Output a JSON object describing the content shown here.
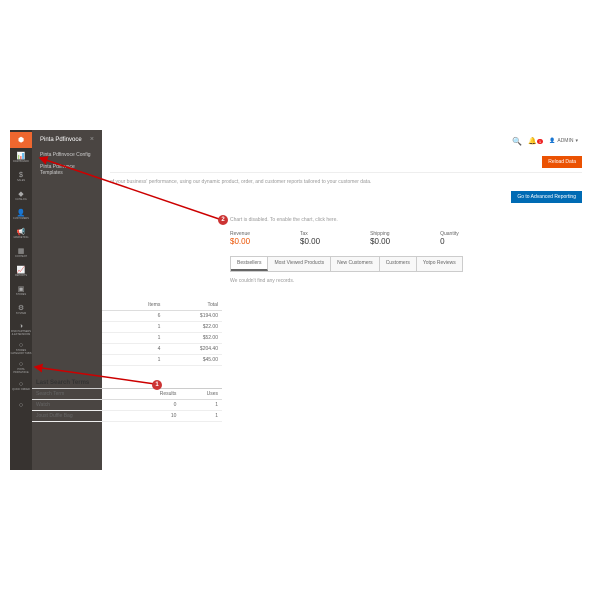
{
  "sidebar": {
    "items": [
      {
        "icon": "⬢",
        "label": ""
      },
      {
        "icon": "📊",
        "label": "DASHBOARD"
      },
      {
        "icon": "$",
        "label": "SALES"
      },
      {
        "icon": "◆",
        "label": "CATALOG"
      },
      {
        "icon": "👤",
        "label": "CUSTOMERS"
      },
      {
        "icon": "📢",
        "label": "MARKETING"
      },
      {
        "icon": "▦",
        "label": "CONTENT"
      },
      {
        "icon": "📈",
        "label": "REPORTS"
      },
      {
        "icon": "▣",
        "label": "STORES"
      },
      {
        "icon": "⚙",
        "label": "SYSTEM"
      },
      {
        "icon": "◑",
        "label": "FIND PARTNERS & EXTENSIONS"
      },
      {
        "icon": "○",
        "label": "STORES CATEGORY TABS"
      },
      {
        "icon": "○",
        "label": "PINTA PDFINVOICE"
      },
      {
        "icon": "○",
        "label": "QUICK ORDER"
      },
      {
        "icon": "○",
        "label": ""
      }
    ]
  },
  "flyout": {
    "title": "Pinta Pdfinvoce",
    "items": [
      "Pinta Pdfinvoce Config",
      "Pinta Pdfinvoce Templates"
    ]
  },
  "topbar": {
    "admin": "ADMIN",
    "notif": "1"
  },
  "buttons": {
    "reload": "Reload Data",
    "advanced": "Go to Advanced Reporting"
  },
  "desc": "of your business' performance, using our dynamic product, order, and customer reports tailored to your customer data.",
  "chart_note": "Chart is disabled. To enable the chart, click here.",
  "metrics": [
    {
      "label": "Revenue",
      "value": "$0.00",
      "cls": "rev"
    },
    {
      "label": "Tax",
      "value": "$0.00"
    },
    {
      "label": "Shipping",
      "value": "$0.00"
    },
    {
      "label": "Quantity",
      "value": "0"
    }
  ],
  "tabs": [
    "Bestsellers",
    "Most Viewed Products",
    "New Customers",
    "Customers",
    "Yotpo Reviews"
  ],
  "tab_empty": "We couldn't find any records.",
  "grid": {
    "headers": [
      "",
      "Items",
      "Total"
    ],
    "rows": [
      [
        "",
        "6",
        "$194.00"
      ],
      [
        "",
        "1",
        "$22.00"
      ],
      [
        "",
        "1",
        "$52.00"
      ],
      [
        "",
        "4",
        "$204.40"
      ],
      [
        "",
        "1",
        "$45.00"
      ]
    ]
  },
  "search": {
    "title": "Last Search Terms",
    "headers": [
      "Search Term",
      "Results",
      "Uses"
    ],
    "rows": [
      [
        "Watch",
        "0",
        "1"
      ],
      [
        "Joust Duffle Bag",
        "10",
        "1"
      ]
    ]
  },
  "markers": {
    "m1": "1",
    "m2": "2"
  }
}
